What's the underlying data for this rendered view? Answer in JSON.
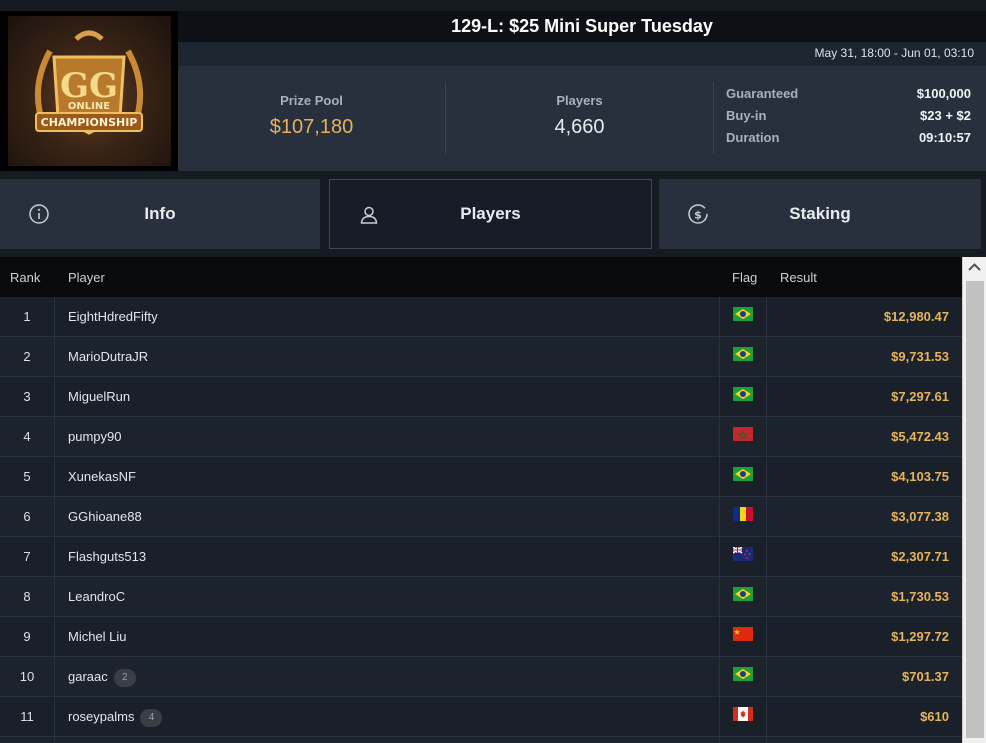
{
  "header": {
    "title": "129-L: $25 Mini Super Tuesday",
    "dates": "May 31, 18:00 - Jun 01, 03:10",
    "logo_text_1": "ONLINE",
    "logo_text_2": "CHAMPIONSHIP"
  },
  "stats": {
    "prize_label": "Prize Pool",
    "prize_value": "$107,180",
    "players_label": "Players",
    "players_value": "4,660",
    "details": [
      {
        "label": "Guaranteed",
        "value": "$100,000"
      },
      {
        "label": "Buy-in",
        "value": "$23 + $2"
      },
      {
        "label": "Duration",
        "value": "09:10:57"
      }
    ]
  },
  "tabs": [
    {
      "label": "Info",
      "icon": "info-icon"
    },
    {
      "label": "Players",
      "icon": "user-icon",
      "active": true
    },
    {
      "label": "Staking",
      "icon": "dollar-coin-icon"
    }
  ],
  "table": {
    "columns": [
      "Rank",
      "Player",
      "Flag",
      "Result"
    ],
    "rows": [
      {
        "rank": "1",
        "player": "EightHdredFifty",
        "flag": "brazil",
        "result": "$12,980.47"
      },
      {
        "rank": "2",
        "player": "MarioDutraJR",
        "flag": "brazil",
        "result": "$9,731.53"
      },
      {
        "rank": "3",
        "player": "MiguelRun",
        "flag": "brazil",
        "result": "$7,297.61"
      },
      {
        "rank": "4",
        "player": "pumpy90",
        "flag": "morocco",
        "result": "$5,472.43"
      },
      {
        "rank": "5",
        "player": "XunekasNF",
        "flag": "brazil",
        "result": "$4,103.75"
      },
      {
        "rank": "6",
        "player": "GGhioane88",
        "flag": "romania",
        "result": "$3,077.38"
      },
      {
        "rank": "7",
        "player": "Flashguts513",
        "flag": "new-zealand",
        "result": "$2,307.71"
      },
      {
        "rank": "8",
        "player": "LeandroC",
        "flag": "brazil",
        "result": "$1,730.53"
      },
      {
        "rank": "9",
        "player": "Michel Liu",
        "flag": "china",
        "result": "$1,297.72"
      },
      {
        "rank": "10",
        "player": "garaac",
        "badge": "2",
        "flag": "brazil",
        "result": "$701.37"
      },
      {
        "rank": "11",
        "player": "roseypalms",
        "badge": "4",
        "flag": "canada",
        "result": "$610"
      },
      {
        "rank": "",
        "player": "",
        "flag": "",
        "result": ""
      }
    ]
  },
  "colors": {
    "accent_gold": "#e5b45e",
    "background": "#161b22",
    "panel": "#27303c"
  }
}
